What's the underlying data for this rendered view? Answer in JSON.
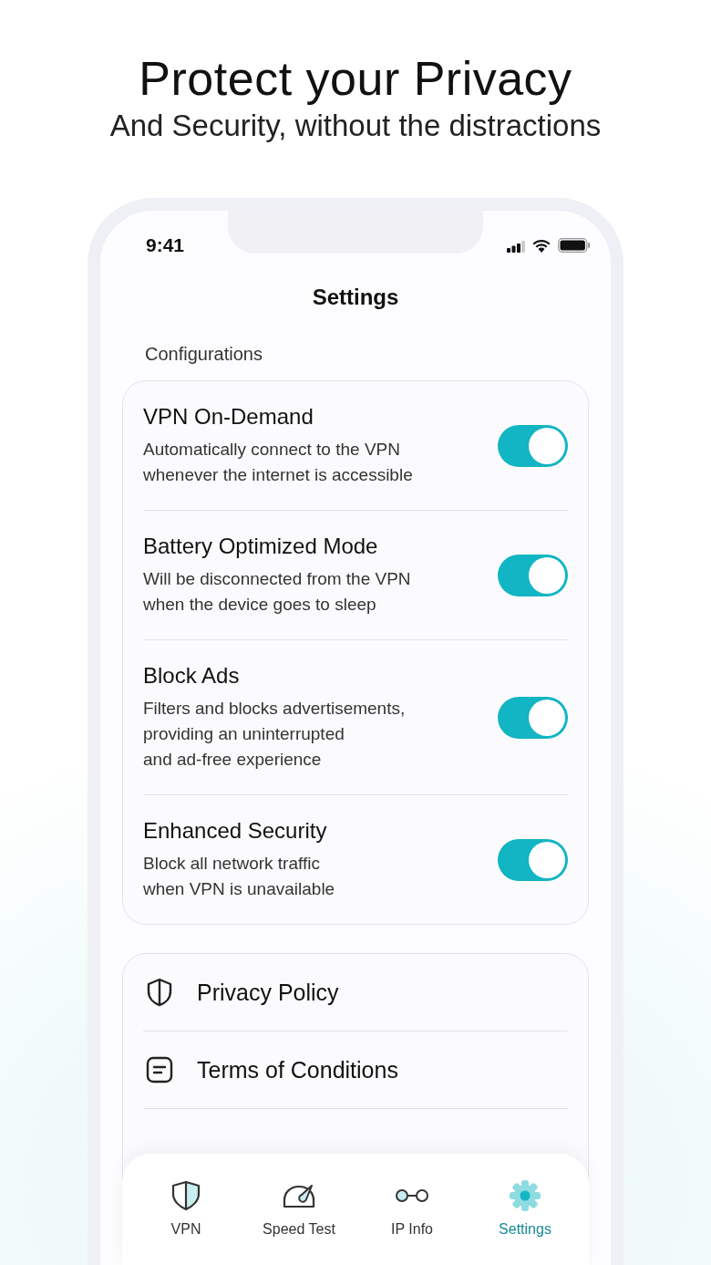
{
  "header": {
    "title": "Protect your Privacy",
    "subtitle": "And Security, without the distractions"
  },
  "status_bar": {
    "time": "9:41"
  },
  "screen": {
    "title": "Settings"
  },
  "configurations": {
    "heading": "Configurations",
    "items": [
      {
        "title": "VPN On-Demand",
        "description": "Automatically connect to the VPN\nwhenever the internet is accessible",
        "on": true
      },
      {
        "title": "Battery Optimized Mode",
        "description": "Will be disconnected from the VPN\nwhen the device goes to sleep",
        "on": true
      },
      {
        "title": "Block Ads",
        "description": "Filters and blocks advertisements,\nproviding an uninterrupted\nand ad-free experience",
        "on": true
      },
      {
        "title": "Enhanced Security",
        "description": "Block all network traffic\nwhen VPN is unavailable",
        "on": true
      }
    ]
  },
  "links": [
    {
      "label": "Privacy Policy"
    },
    {
      "label": "Terms of Conditions"
    }
  ],
  "tab_bar": [
    {
      "label": "VPN",
      "selected": false
    },
    {
      "label": "Speed Test",
      "selected": false
    },
    {
      "label": "IP Info",
      "selected": false
    },
    {
      "label": "Settings",
      "selected": true
    }
  ]
}
